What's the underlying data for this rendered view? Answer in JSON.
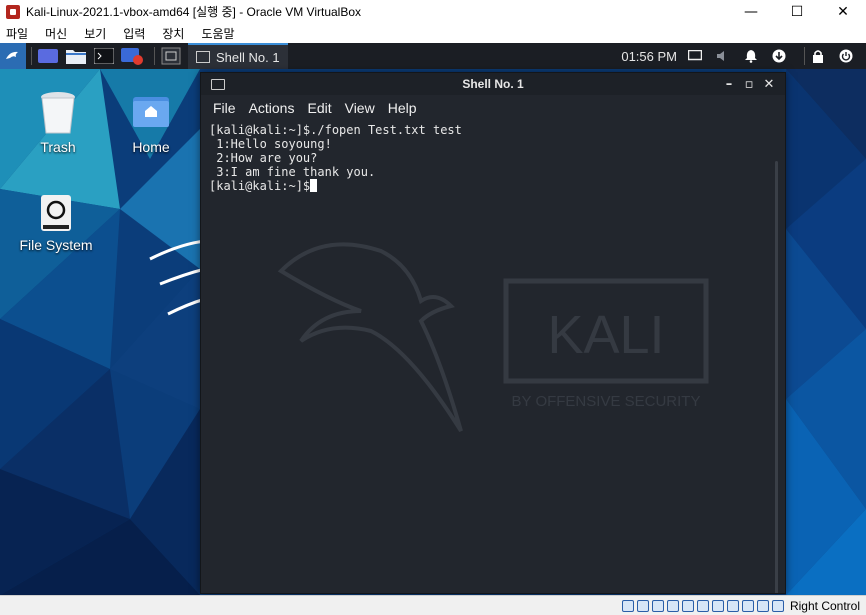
{
  "host_window": {
    "title": "Kali-Linux-2021.1-vbox-amd64 [실행 중] - Oracle VM VirtualBox",
    "controls": {
      "minimize": "—",
      "maximize": "☐",
      "close": "✕"
    },
    "menu": [
      "파일",
      "머신",
      "보기",
      "입력",
      "장치",
      "도움말"
    ]
  },
  "kali_panel": {
    "active_task": "Shell No. 1",
    "clock": "01:56 PM",
    "icons": [
      "kali-menu-icon",
      "workspace-icon",
      "files-icon",
      "terminal-icon",
      "browser-icon",
      "window-icon",
      "display-icon",
      "volume-icon",
      "notification-icon",
      "update-icon",
      "lock-icon",
      "power-icon"
    ]
  },
  "desktop": {
    "icons": [
      {
        "label": "Trash"
      },
      {
        "label": "Home"
      },
      {
        "label": "File System"
      }
    ]
  },
  "terminal": {
    "title": "Shell No. 1",
    "menu": [
      "File",
      "Actions",
      "Edit",
      "View",
      "Help"
    ],
    "lines": [
      "[kali@kali:~]$./fopen Test.txt test",
      " 1:Hello soyoung!",
      " 2:How are you?",
      " 3:I am fine thank you.",
      "[kali@kali:~]$"
    ],
    "watermark": {
      "brand": "KALI",
      "tagline": "BY OFFENSIVE SECURITY"
    }
  },
  "host_status": {
    "host_key_label": "Right Control"
  },
  "colors": {
    "panel_bg": "#1b1e24",
    "terminal_bg": "#22262d",
    "accent": "#3b8ed8"
  }
}
